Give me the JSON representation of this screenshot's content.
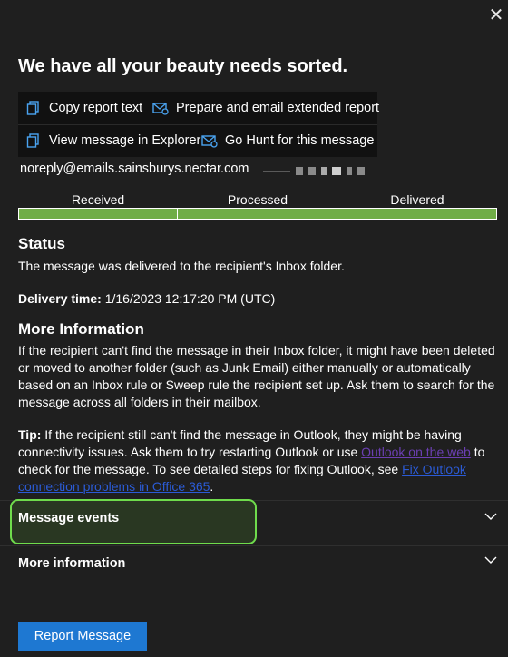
{
  "dialog": {
    "close_icon": "close-icon",
    "title": "We have all your beauty needs sorted."
  },
  "toolbar": {
    "copy_label": "Copy report text",
    "prepare_label": "Prepare and email extended report",
    "view_label": "View message in Explorer",
    "hunt_label": "Go Hunt for this message",
    "icons": [
      "copy-icon",
      "mail-report-icon",
      "copy-icon",
      "mail-hunt-icon"
    ],
    "accent_color": "#4aa3f0"
  },
  "message": {
    "sender": "noreply@emails.sainsburys.nectar.com",
    "recipient": "redacted"
  },
  "progress": {
    "stages": [
      "Received",
      "Processed",
      "Delivered"
    ],
    "bar_color": "#70ad47"
  },
  "status": {
    "heading": "Status",
    "text": "The message was delivered to the recipient's Inbox folder.",
    "delivery_label": "Delivery time:",
    "delivery_value": "1/16/2023 12:17:20 PM (UTC)"
  },
  "more_info": {
    "heading": "More Information",
    "paragraph": "If the recipient can't find the message in their Inbox folder, it might have been deleted or moved to another folder (such as Junk Email) either manually or automatically based on an Inbox rule or Sweep rule the recipient set up. Ask them to search for the message across all folders in their mailbox.",
    "tip_label": "Tip:",
    "tip_text_1": " If the recipient still can't find the message in Outlook, they might be having connectivity issues. Ask them to try restarting Outlook or use ",
    "tip_link_1": "Outlook on the web",
    "tip_text_2": " to check for the message. To see detailed steps for fixing Outlook, see ",
    "tip_link_2": "Fix Outlook connection problems in Office 365",
    "tip_text_3": "."
  },
  "sections": {
    "message_events": "Message events",
    "more_information": "More information"
  },
  "footer": {
    "report_button": "Report Message",
    "button_color": "#1e78d2"
  }
}
